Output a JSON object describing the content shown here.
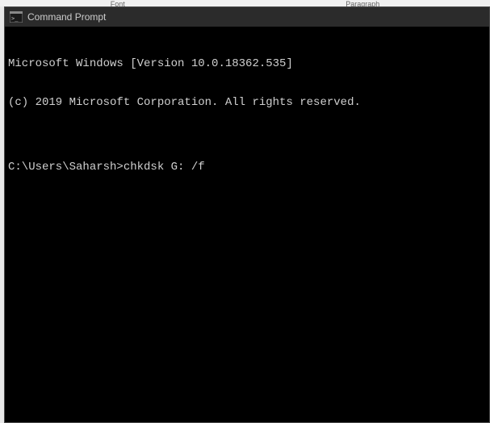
{
  "background": {
    "label1": "Font",
    "label2": "Paragraph"
  },
  "window": {
    "title": "Command Prompt"
  },
  "terminal": {
    "line1": "Microsoft Windows [Version 10.0.18362.535]",
    "line2": "(c) 2019 Microsoft Corporation. All rights reserved.",
    "blank": "",
    "prompt": "C:\\Users\\Saharsh>",
    "command": "chkdsk G: /f"
  }
}
